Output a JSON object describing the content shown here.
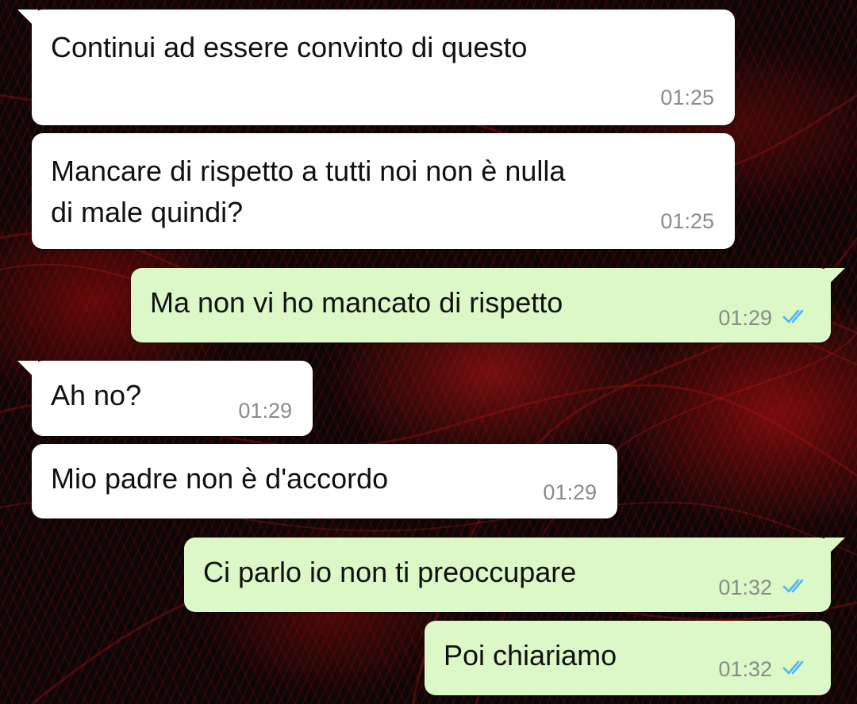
{
  "chat": {
    "messages": [
      {
        "direction": "in",
        "text": "Continui ad essere convinto di questo",
        "time": "01:25"
      },
      {
        "direction": "in",
        "text": "Mancare di rispetto a tutti noi non è nulla\ndi male quindi?",
        "time": "01:25"
      },
      {
        "direction": "out",
        "text": "Ma non vi ho mancato di rispetto",
        "time": "01:29",
        "status": "read"
      },
      {
        "direction": "in",
        "text": "Ah no?",
        "time": "01:29"
      },
      {
        "direction": "in",
        "text": "Mio padre non è d'accordo",
        "time": "01:29"
      },
      {
        "direction": "out",
        "text": "Ci parlo io non ti preoccupare",
        "time": "01:32",
        "status": "read"
      },
      {
        "direction": "out",
        "text": "Poi chiariamo",
        "time": "01:32",
        "status": "read"
      }
    ]
  },
  "colors": {
    "incoming_bubble": "#ffffff",
    "outgoing_bubble": "#dcf8c6",
    "read_ticks": "#4fb3f6",
    "timestamp": "#8a8a8a",
    "wallpaper": "#0d0606"
  },
  "icons": {
    "read_status": "double-check-icon"
  }
}
